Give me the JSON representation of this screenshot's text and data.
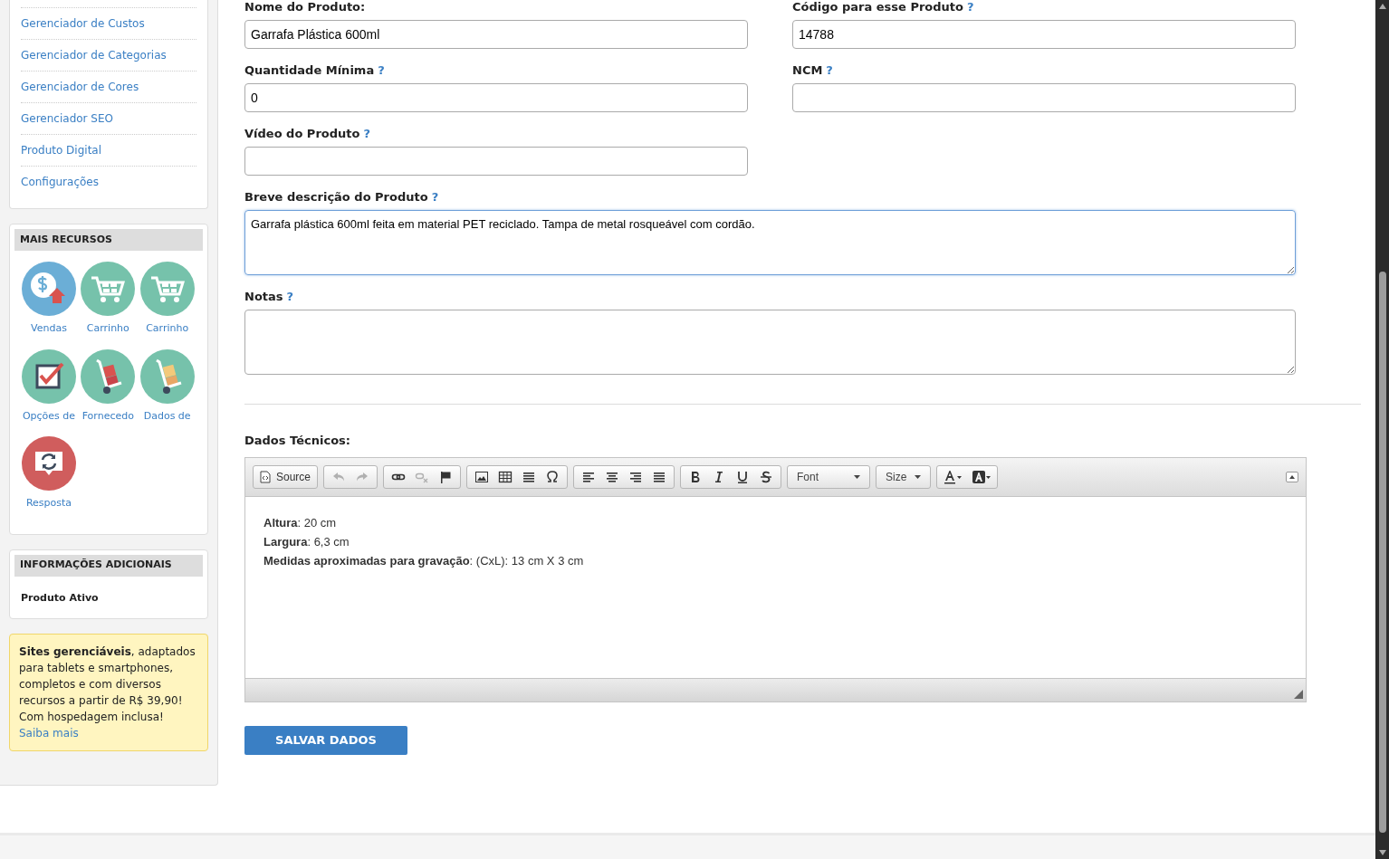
{
  "sidebar": {
    "menu": [
      "Gerenciador de Custos",
      "Gerenciador de Categorias",
      "Gerenciador de Cores",
      "Gerenciador SEO",
      "Produto Digital",
      "Configurações"
    ],
    "resources": {
      "title": "MAIS RECURSOS",
      "items": [
        {
          "kind": "sales",
          "label": "Vendas"
        },
        {
          "kind": "cart",
          "label": "Carrinho"
        },
        {
          "kind": "cart",
          "label": "Carrinho"
        },
        {
          "kind": "checkbox",
          "label": "Opções de"
        },
        {
          "kind": "trolley",
          "label": "Fornecedo"
        },
        {
          "kind": "trolley-boxes",
          "label": "Dados de"
        },
        {
          "kind": "chat-refresh",
          "label": "Resposta"
        }
      ]
    },
    "info": {
      "title": "INFORMAÇÕES ADICIONAIS",
      "status": "Produto Ativo"
    },
    "promo": {
      "text": "**Sites gerenciáveis**, adaptados para tablets e smartphones, completos e com diversos recursos a partir de R$ 39,90! Com hospedagem inclusa!",
      "link": "Saiba mais"
    }
  },
  "form": {
    "rows": [
      [
        {
          "label": "Nome do Produto:",
          "value": "Garrafa Plástica 600ml"
        },
        {
          "label": "Código para esse Produto",
          "help": "?",
          "value": "14788"
        }
      ],
      [
        {
          "label": "Quantidade Mínima",
          "help": "?",
          "value": "0"
        },
        {
          "label": "NCM",
          "help": "?"
        }
      ],
      [
        {
          "label": "Vídeo do Produto",
          "help": "?"
        }
      ]
    ],
    "textareas": [
      {
        "label": "Breve descrição do Produto",
        "help": "?",
        "value": "Garrafa plástica 600ml feita em material PET reciclado. Tampa de metal rosqueável com cordão.",
        "focused": true
      },
      {
        "label": "Notas",
        "help": "?",
        "focused": false
      }
    ],
    "editor": {
      "label": "Dados Técnicos:",
      "source_button": "Source",
      "font_select": "Font",
      "size_select": "Size",
      "lines": [
        "**Altura**: 20 cm",
        "**Largura**: 6,3 cm",
        "**Medidas aproximadas para gravação**: (CxL): 13 cm X 3 cm"
      ]
    },
    "save_button": "SALVAR DADOS"
  }
}
